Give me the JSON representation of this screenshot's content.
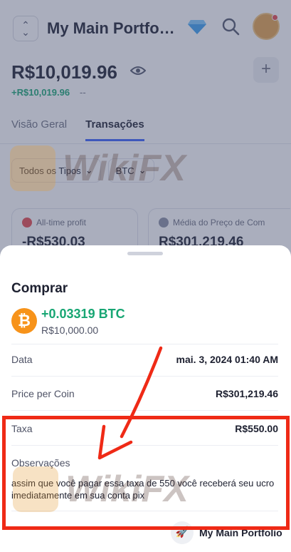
{
  "header": {
    "portfolio_title": "My Main Portfo…",
    "switch_icon": "chevron-up-down-icon",
    "diamond_icon": "diamond-icon",
    "search_icon": "search-icon"
  },
  "balance": {
    "total": "R$10,019.96",
    "change": "+R$10,019.96",
    "change_pct": "--"
  },
  "tabs": [
    {
      "label": "Visão Geral"
    },
    {
      "label": "Transações"
    }
  ],
  "filters": [
    {
      "label": "Todos os Tipos"
    },
    {
      "label": "BTC"
    }
  ],
  "stats": [
    {
      "label": "All-time profit",
      "value": "-R$530.03"
    },
    {
      "label": "Média do Preço de Com",
      "value": "R$301,219.46"
    }
  ],
  "sheet": {
    "title": "Comprar",
    "coin_symbol": "₿",
    "amount": "+0.03319 BTC",
    "fiat_value": "R$10,000.00",
    "rows": [
      {
        "key": "Data",
        "value": "mai. 3, 2024 01:40 AM"
      },
      {
        "key": "Price per Coin",
        "value": "R$301,219.46"
      },
      {
        "key": "Taxa",
        "value": "R$550.00"
      }
    ],
    "notes_label": "Observações",
    "notes_text": "assim que você pagar essa taxa de 550 você receberá seu ucro imediatamente em sua conta pix",
    "footer_portfolio": "My Main Portfolio"
  },
  "watermark": {
    "text": "WikiFX"
  },
  "colors": {
    "accent": "#3861fb",
    "positive": "#17a673",
    "annotation_red": "#ef2a16",
    "bitcoin": "#f7931a"
  }
}
